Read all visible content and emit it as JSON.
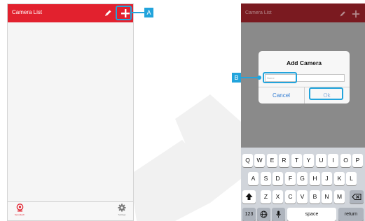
{
  "left_phone": {
    "title": "Camera List",
    "tabs": [
      {
        "label": "Securitech",
        "icon": "camera-icon"
      },
      {
        "label": "Settings",
        "icon": "gear-icon"
      }
    ]
  },
  "callouts": {
    "a": "A",
    "b": "B"
  },
  "right_phone": {
    "title": "Camera List",
    "dialog": {
      "title": "Add Camera",
      "input_placeholder": "Name",
      "cancel_label": "Cancel",
      "ok_label": "Ok"
    },
    "keyboard": {
      "row1": [
        "Q",
        "W",
        "E",
        "R",
        "T",
        "Y",
        "U",
        "I",
        "O",
        "P"
      ],
      "row2": [
        "A",
        "S",
        "D",
        "F",
        "G",
        "H",
        "J",
        "K",
        "L"
      ],
      "row3": [
        "Z",
        "X",
        "C",
        "V",
        "B",
        "N",
        "M"
      ],
      "numbers_key": "123",
      "space_key": "space",
      "return_key": "return"
    }
  },
  "colors": {
    "header_red": "#e2212e",
    "header_red_dimmed": "#7a1a20",
    "callout_blue": "#22a4dc",
    "dialog_button_blue": "#2f7bd2",
    "overlay_gray": "#8a8a8a"
  }
}
